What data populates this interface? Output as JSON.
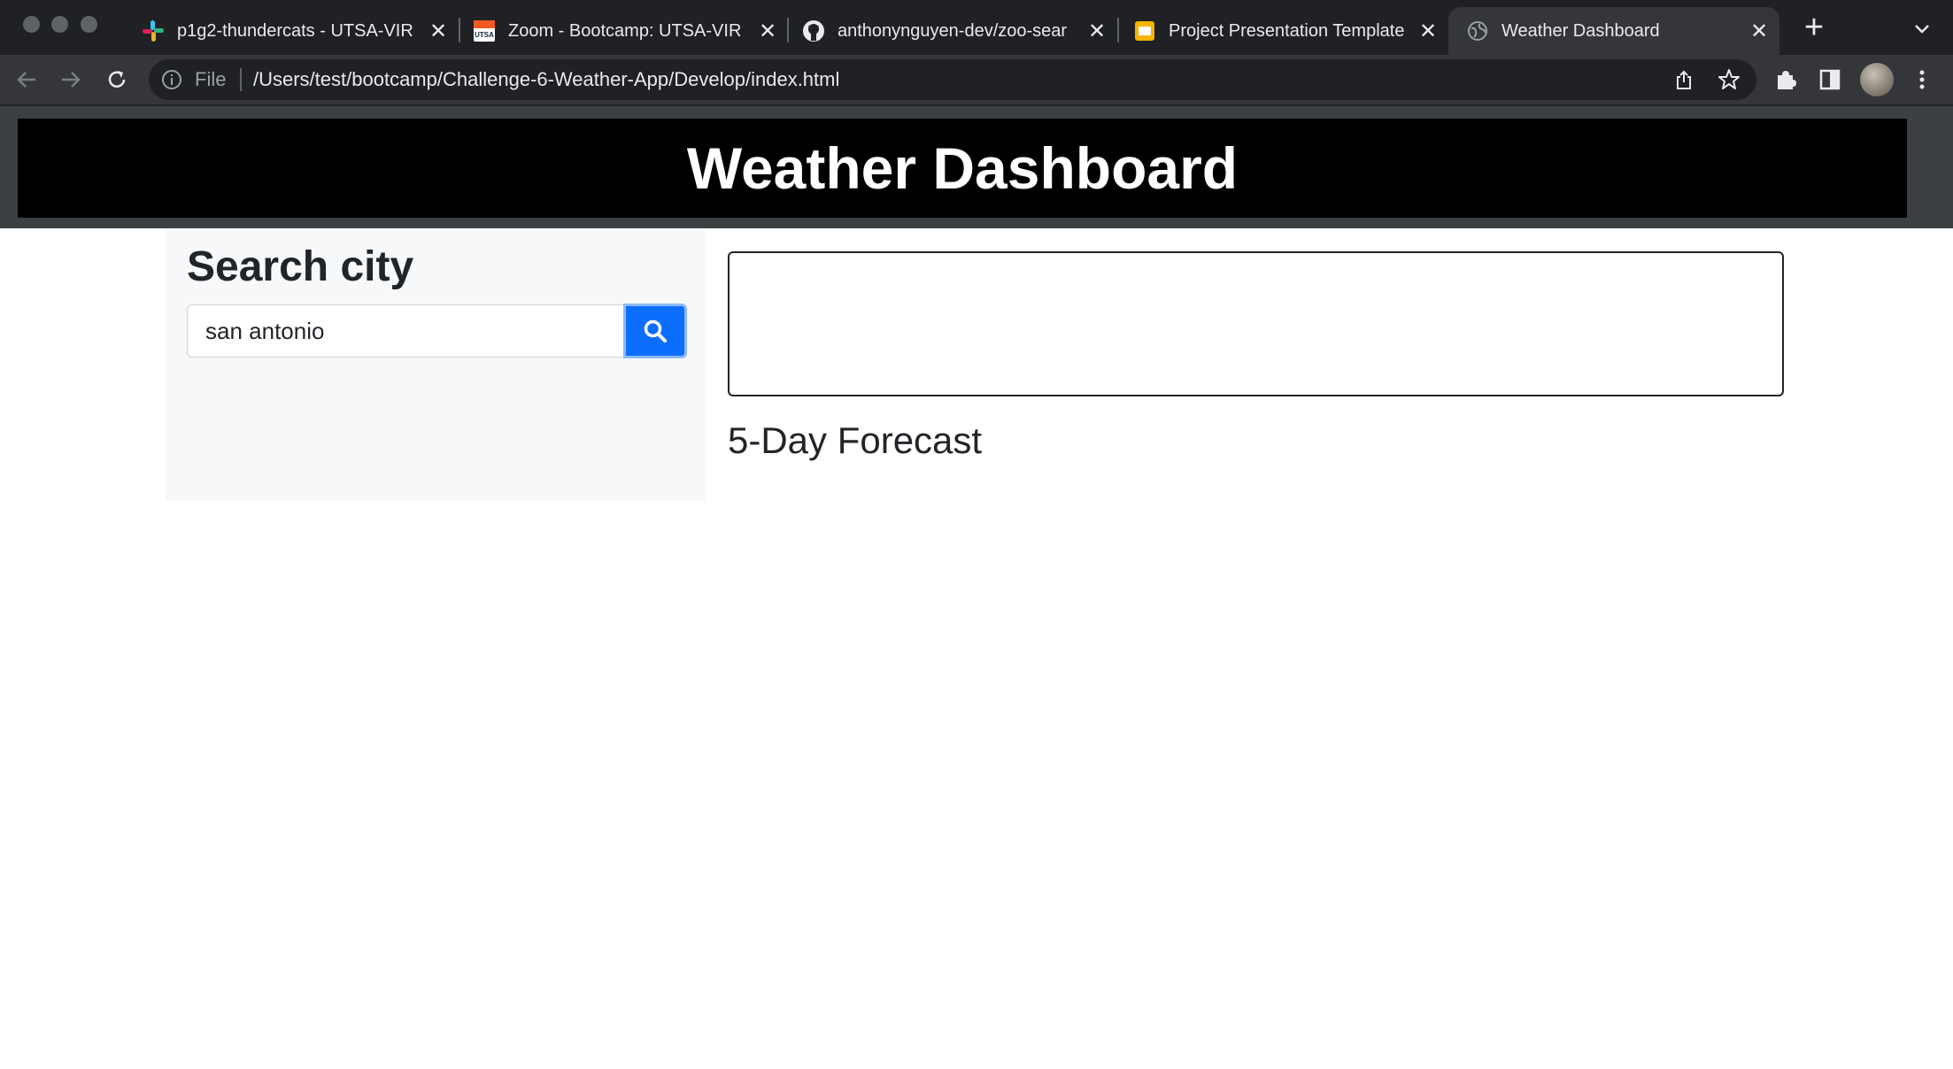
{
  "browser": {
    "tabs": [
      {
        "title": "p1g2-thundercats - UTSA-VIR",
        "icon": "slack-icon",
        "active": false
      },
      {
        "title": "Zoom - Bootcamp: UTSA-VIR",
        "icon": "utsa-icon",
        "active": false
      },
      {
        "title": "anthonynguyen-dev/zoo-sear",
        "icon": "github-icon",
        "active": false
      },
      {
        "title": "Project Presentation Template",
        "icon": "slides-icon",
        "active": false
      },
      {
        "title": "Weather Dashboard",
        "icon": "globe-icon",
        "active": true
      }
    ],
    "address": {
      "scheme_label": "File",
      "url": "/Users/test/bootcamp/Challenge-6-Weather-App/Develop/index.html"
    }
  },
  "page": {
    "header": {
      "title": "Weather Dashboard"
    },
    "sidebar": {
      "heading": "Search city",
      "search_value": "san antonio",
      "search_button_icon": "search-icon",
      "accent_color": "#0d6efd"
    },
    "main": {
      "current_weather": "",
      "forecast_heading": "5-Day Forecast"
    }
  }
}
